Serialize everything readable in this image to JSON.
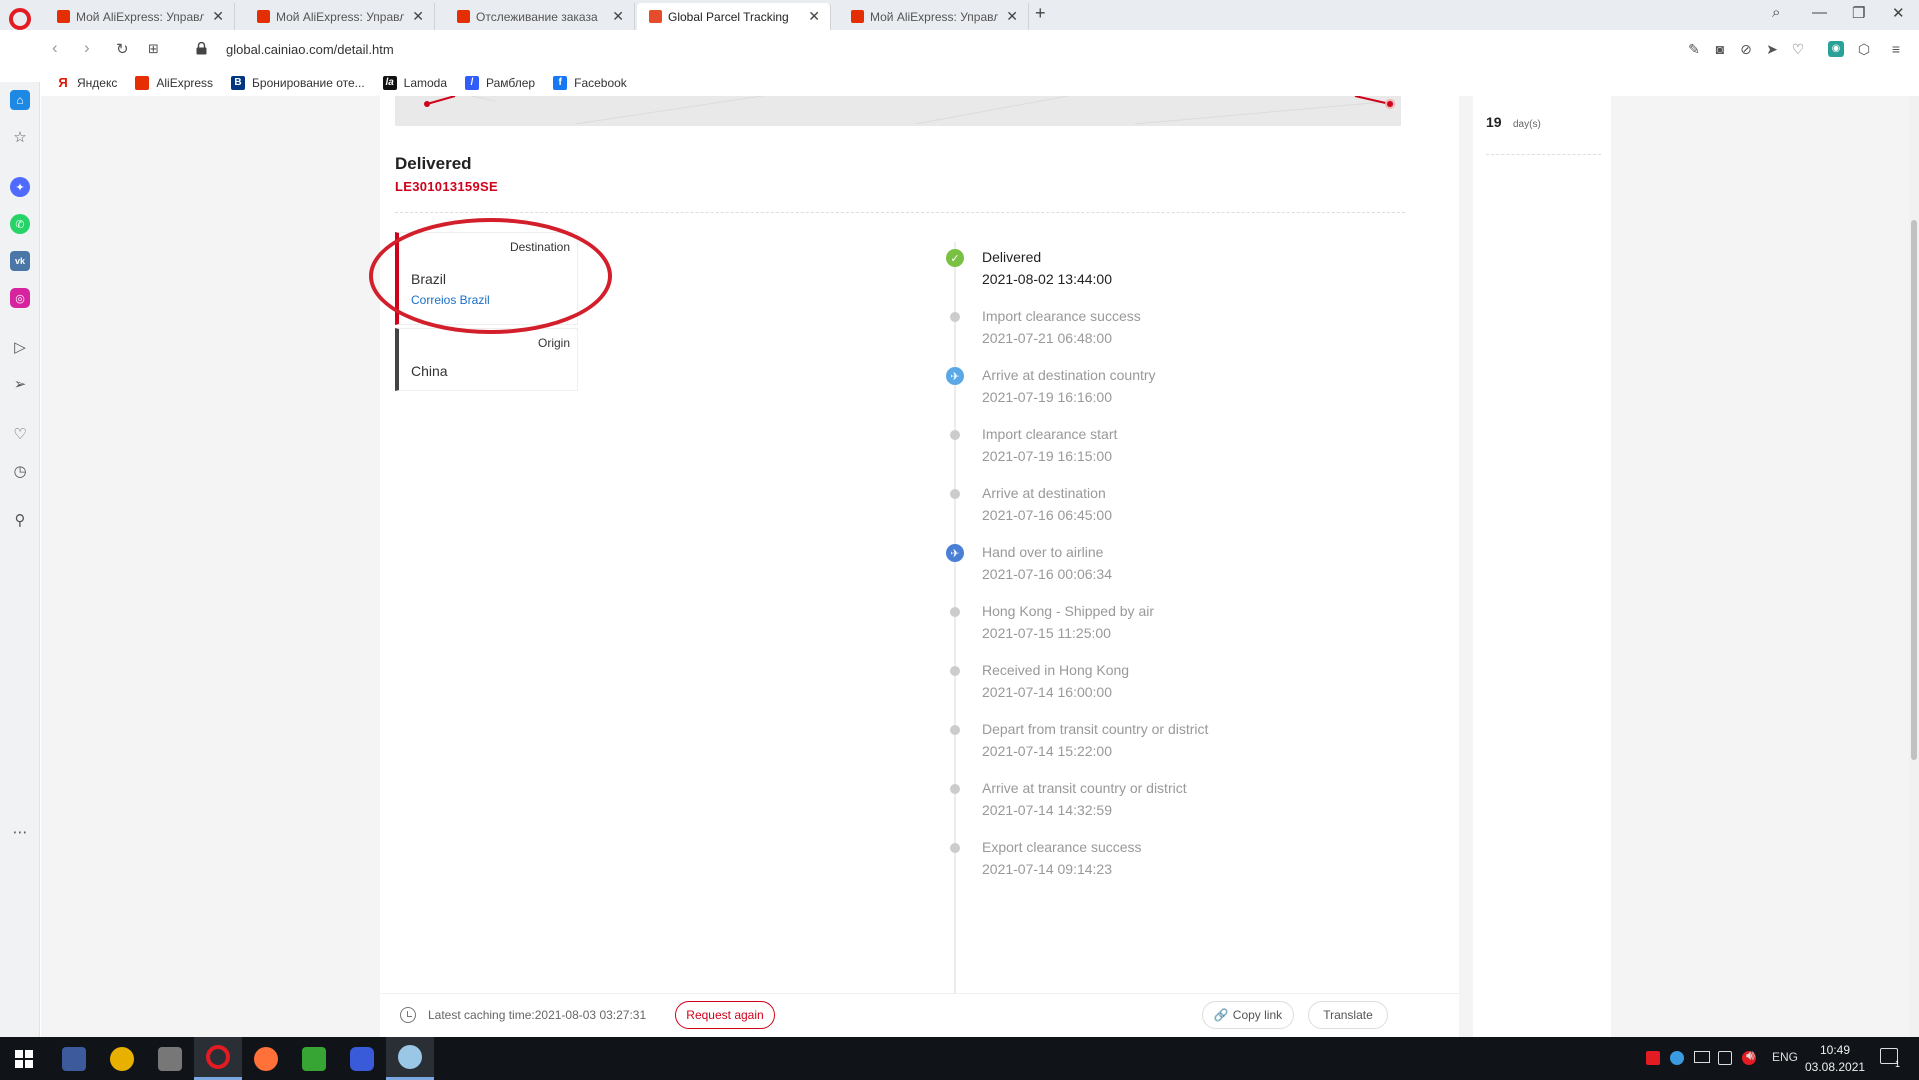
{
  "browser": {
    "tabs": [
      {
        "title": "Мой AliExpress: Управлять",
        "favicon": "aliexpress-icon"
      },
      {
        "title": "Мой AliExpress: Управлять",
        "favicon": "aliexpress-icon"
      },
      {
        "title": "Отслеживание заказа",
        "favicon": "aliexpress-icon"
      },
      {
        "title": "Global Parcel Tracking",
        "favicon": "cainiao-icon",
        "active": true
      },
      {
        "title": "Мой AliExpress: Управлять",
        "favicon": "aliexpress-icon"
      }
    ],
    "url": "global.cainiao.com/detail.htm",
    "bookmarks": [
      {
        "label": "Яндекс",
        "icon": "yandex-icon",
        "color": "#e61400"
      },
      {
        "label": "AliExpress",
        "icon": "aliexpress-icon",
        "color": "#e62e04"
      },
      {
        "label": "Бронирование оте...",
        "icon": "booking-icon",
        "color": "#003580"
      },
      {
        "label": "Lamoda",
        "icon": "lamoda-icon",
        "color": "#111111"
      },
      {
        "label": "Рамблер",
        "icon": "rambler-icon",
        "color": "#315efb"
      },
      {
        "label": "Facebook",
        "icon": "facebook-icon",
        "color": "#1877f2"
      }
    ]
  },
  "parcel": {
    "status_title": "Delivered",
    "tracking_number": "LE301013159SE",
    "destination": {
      "label": "Destination",
      "country": "Brazil",
      "carrier": "Correios Brazil"
    },
    "origin": {
      "label": "Origin",
      "country": "China"
    },
    "events": [
      {
        "title": "Delivered",
        "date": "2021-08-02 13:44:00",
        "marker": "check-icon"
      },
      {
        "title": "Import clearance success",
        "date": "2021-07-21 06:48:00",
        "marker": "dot"
      },
      {
        "title": "Arrive at destination country",
        "date": "2021-07-19 16:16:00",
        "marker": "plane-landing-icon"
      },
      {
        "title": "Import clearance start",
        "date": "2021-07-19 16:15:00",
        "marker": "dot"
      },
      {
        "title": "Arrive at destination",
        "date": "2021-07-16 06:45:00",
        "marker": "dot"
      },
      {
        "title": "Hand over to airline",
        "date": "2021-07-16 00:06:34",
        "marker": "plane-takeoff-icon"
      },
      {
        "title": "Hong Kong - Shipped by air",
        "date": "2021-07-15 11:25:00",
        "marker": "dot"
      },
      {
        "title": "Received in Hong Kong",
        "date": "2021-07-14 16:00:00",
        "marker": "dot"
      },
      {
        "title": "Depart from transit country or district",
        "date": "2021-07-14 15:22:00",
        "marker": "dot"
      },
      {
        "title": "Arrive at transit country or district",
        "date": "2021-07-14 14:32:59",
        "marker": "dot"
      },
      {
        "title": "Export clearance success",
        "date": "2021-07-14 09:14:23",
        "marker": "dot"
      }
    ],
    "transit_days": {
      "value": "19",
      "unit": "day(s)"
    }
  },
  "footer": {
    "cache_text": "Latest caching time:2021-08-03 03:27:31",
    "request_again": "Request again",
    "copy_link": "Copy link",
    "translate": "Translate"
  },
  "taskbar": {
    "language": "ENG",
    "time": "10:49",
    "date": "03.08.2021",
    "notifications": "1"
  },
  "colors": {
    "accent_red": "#d0021b",
    "link_blue": "#1a6fc9",
    "success_green": "#7ac143",
    "plane_blue": "#5aa9e6"
  }
}
